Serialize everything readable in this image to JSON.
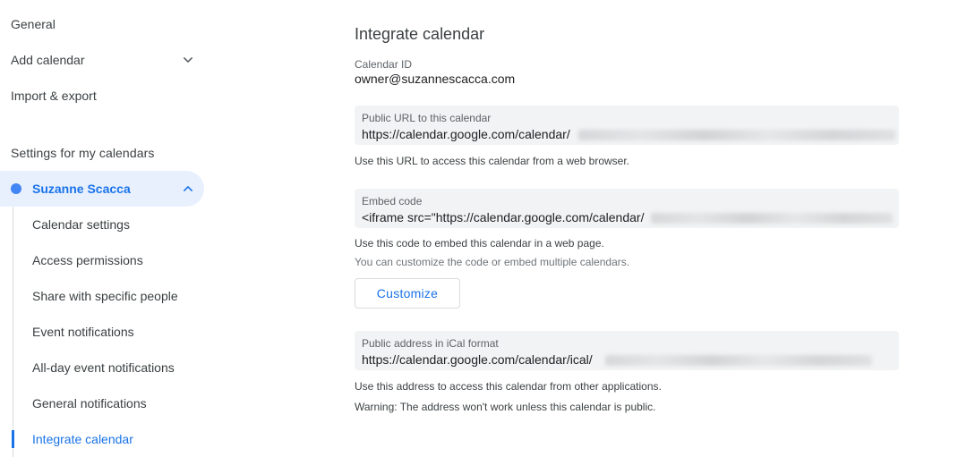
{
  "sidebar": {
    "general": "General",
    "add_calendar": "Add calendar",
    "import_export": "Import & export",
    "section_title": "Settings for my calendars",
    "calendar": {
      "name": "Suzanne Scacca",
      "color": "#4285f4"
    },
    "sub_items": [
      {
        "label": "Calendar settings"
      },
      {
        "label": "Access permissions"
      },
      {
        "label": "Share with specific people"
      },
      {
        "label": "Event notifications"
      },
      {
        "label": "All-day event notifications"
      },
      {
        "label": "General notifications"
      },
      {
        "label": "Integrate calendar",
        "active": true
      }
    ],
    "icons": {
      "add_calendar_chevron": "chevron-down-icon",
      "calendar_chevron": "chevron-up-icon"
    }
  },
  "main": {
    "title": "Integrate calendar",
    "calendar_id": {
      "label": "Calendar ID",
      "value": "owner@suzannescacca.com"
    },
    "public_url": {
      "label": "Public URL to this calendar",
      "value": "https://calendar.google.com/calendar/",
      "help": "Use this URL to access this calendar from a web browser."
    },
    "embed_code": {
      "label": "Embed code",
      "value": "<iframe src=\"https://calendar.google.com/calendar/",
      "help": "Use this code to embed this calendar in a web page.",
      "subhelp": "You can customize the code or embed multiple calendars."
    },
    "customize_button": "Customize",
    "ical": {
      "label": "Public address in iCal format",
      "value": "https://calendar.google.com/calendar/ical/",
      "help": "Use this address to access this calendar from other applications.",
      "warning": "Warning: The address won't work unless this calendar is public."
    }
  },
  "colors": {
    "accent": "#1a73e8",
    "selected_bg": "#e8f0fe",
    "field_bg": "#f1f3f4"
  }
}
